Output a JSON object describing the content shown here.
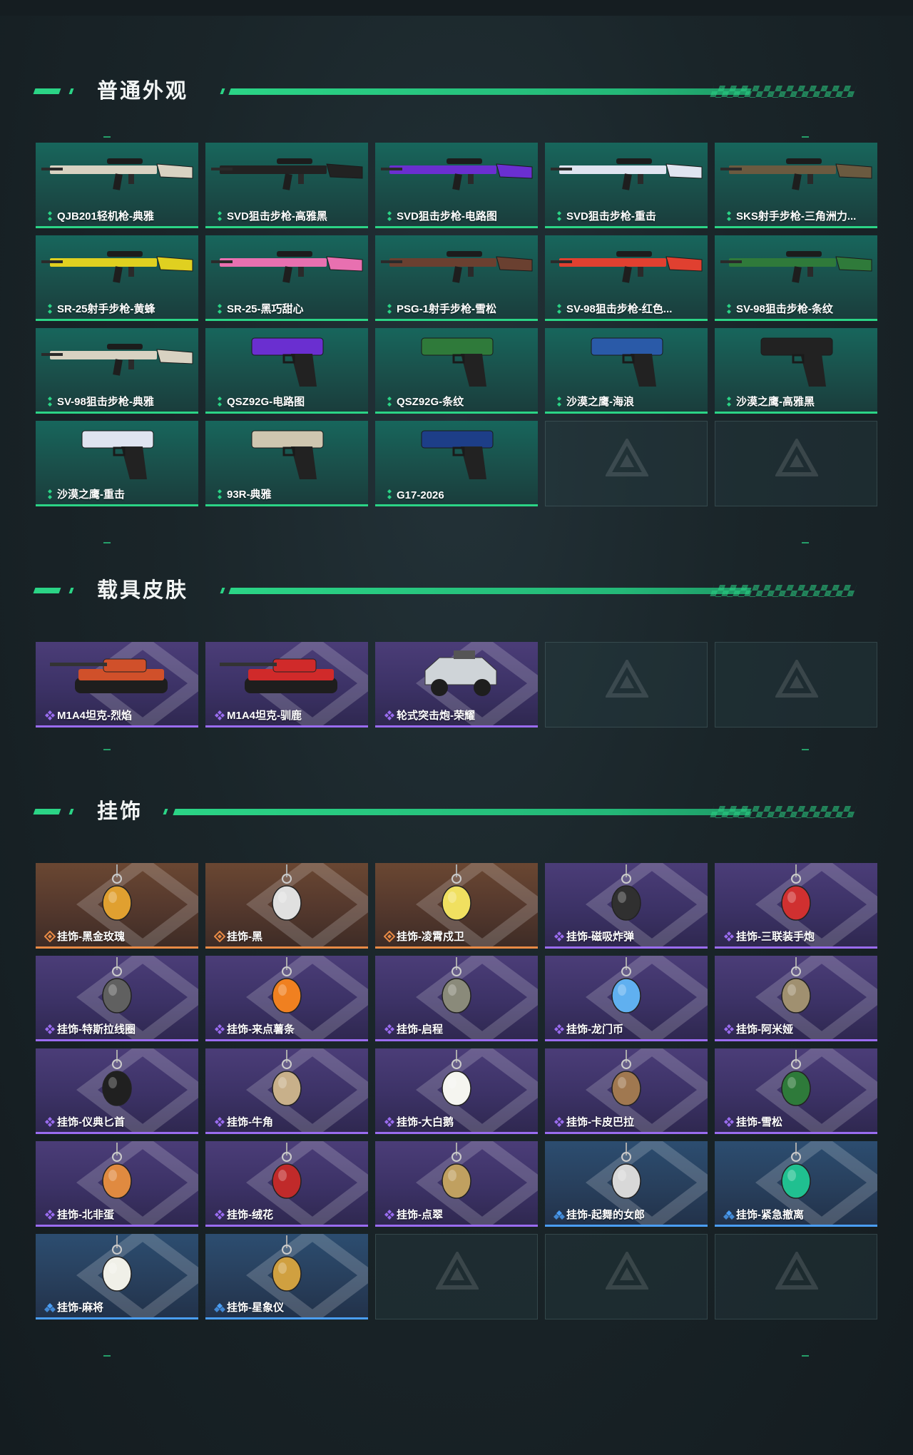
{
  "sections": [
    {
      "title": "普通外观",
      "items": [
        {
          "label": "QJB201轻机枪-典雅",
          "rarity": "green",
          "icon": "lmg-rifle-icon",
          "color": "#d8d2c2"
        },
        {
          "label": "SVD狙击步枪-高雅黑",
          "rarity": "green",
          "icon": "sniper-rifle-icon",
          "color": "#222222"
        },
        {
          "label": "SVD狙击步枪-电路图",
          "rarity": "green",
          "icon": "sniper-rifle-icon",
          "color": "#6a2fd0"
        },
        {
          "label": "SVD狙击步枪-重击",
          "rarity": "green",
          "icon": "sniper-rifle-icon",
          "color": "#dfe4f0"
        },
        {
          "label": "SKS射手步枪-三角洲力...",
          "rarity": "green",
          "icon": "marksman-rifle-icon",
          "color": "#6b5a40"
        },
        {
          "label": "SR-25射手步枪-黄蜂",
          "rarity": "green",
          "icon": "marksman-rifle-icon",
          "color": "#e0d020"
        },
        {
          "label": "SR-25-黑巧甜心",
          "rarity": "green",
          "icon": "marksman-rifle-icon",
          "color": "#e870b0"
        },
        {
          "label": "PSG-1射手步枪-雪松",
          "rarity": "green",
          "icon": "marksman-rifle-icon",
          "color": "#6a4030"
        },
        {
          "label": "SV-98狙击步枪-红色...",
          "rarity": "green",
          "icon": "sniper-rifle-icon",
          "color": "#e04030"
        },
        {
          "label": "SV-98狙击步枪-条纹",
          "rarity": "green",
          "icon": "sniper-rifle-icon",
          "color": "#2f7a3a"
        },
        {
          "label": "SV-98狙击步枪-典雅",
          "rarity": "green",
          "icon": "sniper-rifle-icon",
          "color": "#d8d2c2"
        },
        {
          "label": "QSZ92G-电路图",
          "rarity": "green",
          "icon": "pistol-icon",
          "color": "#6a2fd0"
        },
        {
          "label": "QSZ92G-条纹",
          "rarity": "green",
          "icon": "pistol-icon",
          "color": "#2f7a3a"
        },
        {
          "label": "沙漠之鹰-海浪",
          "rarity": "green",
          "icon": "pistol-icon",
          "color": "#2a5aa8"
        },
        {
          "label": "沙漠之鹰-高雅黑",
          "rarity": "green",
          "icon": "pistol-icon",
          "color": "#222222"
        },
        {
          "label": "沙漠之鹰-重击",
          "rarity": "green",
          "icon": "pistol-icon",
          "color": "#dfe4f0"
        },
        {
          "label": "93R-典雅",
          "rarity": "green",
          "icon": "pistol-icon",
          "color": "#cfc6b0"
        },
        {
          "label": "G17-2026",
          "rarity": "green",
          "icon": "pistol-icon",
          "color": "#1d3e88"
        }
      ],
      "empty_slots": 2
    },
    {
      "title": "载具皮肤",
      "items": [
        {
          "label": "M1A4坦克-烈焰",
          "rarity": "purple",
          "icon": "tank-icon",
          "color": "#d0502a"
        },
        {
          "label": "M1A4坦克-驯鹿",
          "rarity": "purple",
          "icon": "tank-icon",
          "color": "#d02a2a"
        },
        {
          "label": "轮式突击炮-荣耀",
          "rarity": "purple",
          "icon": "armored-car-icon",
          "color": "#cfd4d8"
        }
      ],
      "empty_slots": 2
    },
    {
      "title": "挂饰",
      "items": [
        {
          "label": "挂饰-黑金玫瑰",
          "rarity": "orange",
          "icon": "charm-rose-icon",
          "color": "#e0a030"
        },
        {
          "label": "挂饰-黑",
          "rarity": "orange",
          "icon": "charm-tag-icon",
          "color": "#e0e0e0"
        },
        {
          "label": "挂饰-凌霄戍卫",
          "rarity": "orange",
          "icon": "charm-duck-icon",
          "color": "#f0e060"
        },
        {
          "label": "挂饰-磁吸炸弹",
          "rarity": "purple",
          "icon": "charm-bomb-icon",
          "color": "#303030"
        },
        {
          "label": "挂饰-三联装手炮",
          "rarity": "purple",
          "icon": "charm-launcher-icon",
          "color": "#d03030"
        },
        {
          "label": "挂饰-特斯拉线圈",
          "rarity": "purple",
          "icon": "charm-coil-icon",
          "color": "#606060"
        },
        {
          "label": "挂饰-来点薯条",
          "rarity": "purple",
          "icon": "charm-fries-icon",
          "color": "#f08020"
        },
        {
          "label": "挂饰-启程",
          "rarity": "purple",
          "icon": "charm-ring-icon",
          "color": "#8a8a7a"
        },
        {
          "label": "挂饰-龙门币",
          "rarity": "purple",
          "icon": "charm-coin-icon",
          "color": "#60b0f0"
        },
        {
          "label": "挂饰-阿米娅",
          "rarity": "purple",
          "icon": "charm-bunny-icon",
          "color": "#a09070"
        },
        {
          "label": "挂饰-仪典匕首",
          "rarity": "purple",
          "icon": "charm-dagger-icon",
          "color": "#202020"
        },
        {
          "label": "挂饰-牛角",
          "rarity": "purple",
          "icon": "charm-horns-icon",
          "color": "#c8b08a"
        },
        {
          "label": "挂饰-大白鹅",
          "rarity": "purple",
          "icon": "charm-goose-icon",
          "color": "#f5f5f0"
        },
        {
          "label": "挂饰-卡皮巴拉",
          "rarity": "purple",
          "icon": "charm-capybara-icon",
          "color": "#a07850"
        },
        {
          "label": "挂饰-雪松",
          "rarity": "purple",
          "icon": "charm-tree-icon",
          "color": "#2e7a3a"
        },
        {
          "label": "挂饰-北非蛋",
          "rarity": "purple",
          "icon": "charm-egg-icon",
          "color": "#e08a40"
        },
        {
          "label": "挂饰-绒花",
          "rarity": "purple",
          "icon": "charm-flower-icon",
          "color": "#c02a2a"
        },
        {
          "label": "挂饰-点翠",
          "rarity": "purple",
          "icon": "charm-bird-icon",
          "color": "#c0a060"
        },
        {
          "label": "挂饰-起舞的女郎",
          "rarity": "blue",
          "icon": "charm-dancer-icon",
          "color": "#d8d8d8"
        },
        {
          "label": "挂饰-紧急撤离",
          "rarity": "blue",
          "icon": "charm-exit-icon",
          "color": "#20c090"
        },
        {
          "label": "挂饰-麻将",
          "rarity": "blue",
          "icon": "charm-mahjong-icon",
          "color": "#f0f0e8"
        },
        {
          "label": "挂饰-星象仪",
          "rarity": "blue",
          "icon": "charm-astrolabe-icon",
          "color": "#d0a040"
        }
      ],
      "empty_slots": 3
    }
  ],
  "colors": {
    "accent_green": "#2bd486",
    "rarity_green": "#2bd486",
    "rarity_purple": "#9a6cf0",
    "rarity_orange": "#e88a45",
    "rarity_blue": "#4a9ef5"
  }
}
